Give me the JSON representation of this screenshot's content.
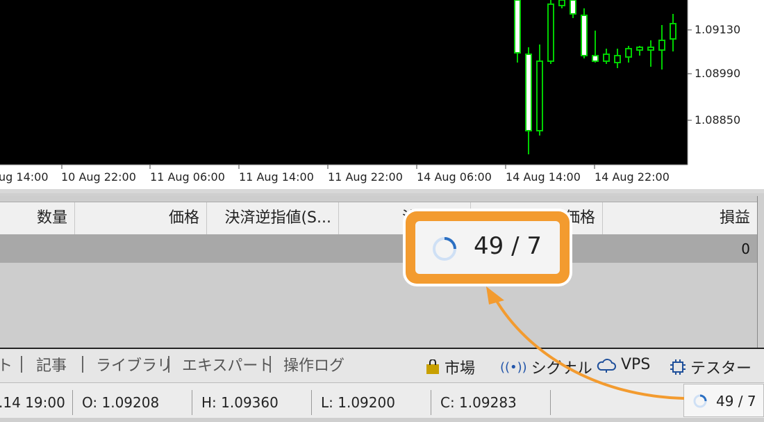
{
  "chart": {
    "x_labels": [
      "ug 14:00",
      "10 Aug 22:00",
      "11 Aug 06:00",
      "11 Aug 14:00",
      "11 Aug 22:00",
      "14 Aug 06:00",
      "14 Aug 14:00",
      "14 Aug 22:00"
    ],
    "y_labels": [
      "1.09130",
      "1.08990",
      "1.08850"
    ],
    "candle_color": "#00e000",
    "background": "#000000"
  },
  "table": {
    "headers": [
      "数量",
      "価格",
      "決済逆指値(S...",
      "決済指値",
      "価格",
      "損益"
    ],
    "row_value": "0"
  },
  "tabs": [
    "ト",
    "記事",
    "ライブラリ",
    "エキスパート",
    "操作ログ"
  ],
  "tools": {
    "market": "市場",
    "signals": "シグナル",
    "vps": "VPS",
    "tester": "テスター"
  },
  "status": {
    "time": ".14 19:00",
    "open": "O: 1.09208",
    "high": "H: 1.09360",
    "low": "L: 1.09200",
    "close": "C: 1.09283",
    "connection": "49 / 7"
  },
  "callout": {
    "text": "49 / 7",
    "color": "#f39b2f"
  }
}
